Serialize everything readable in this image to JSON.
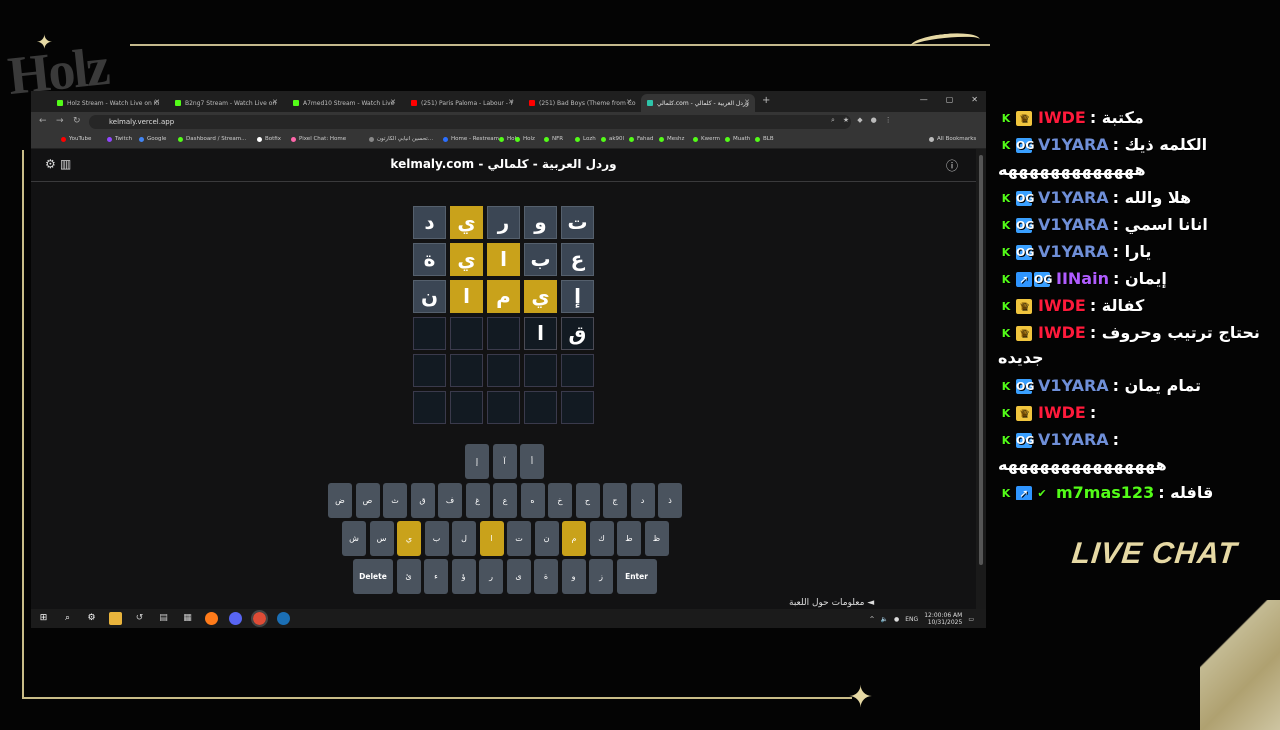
{
  "overlay": {
    "logo_text": "Holz",
    "live_chat_label": "LIVE CHAT"
  },
  "browser": {
    "tabs": [
      {
        "label": "Holz Stream - Watch Live on Ki",
        "color": "#53fc18"
      },
      {
        "label": "B2ng7 Stream - Watch Live on",
        "color": "#53fc18"
      },
      {
        "label": "A7med10 Stream - Watch Live",
        "color": "#53fc18"
      },
      {
        "label": "(251) Paris Paloma - Labour - Y",
        "color": "#ff0000"
      },
      {
        "label": "(251) Bad Boys (Theme from Co",
        "color": "#ff0000"
      },
      {
        "label": "كلمالي.com - وردل العربية - كلمالي",
        "color": "#2ec4a9"
      }
    ],
    "url": "kelmaly.vercel.app",
    "bookmarks": [
      "YouTube",
      "Twitch",
      "Google",
      "Dashboard / Stream...",
      "Botfix",
      "Pixel Chat: Home",
      "تحسين انيابي الكارتون...",
      "Home - Restream",
      "Holz",
      "Holz",
      "NFR",
      "Lozh",
      "ak90l",
      "Fahad",
      "Meshz",
      "Kwerm",
      "Muath",
      "BLB",
      "All Bookmarks"
    ]
  },
  "game": {
    "title": "kelmaly.com - وردل العربية - كلمالي",
    "board": [
      [
        {
          "l": "د",
          "s": "filled"
        },
        {
          "l": "ي",
          "s": "present"
        },
        {
          "l": "ر",
          "s": "filled"
        },
        {
          "l": "و",
          "s": "filled"
        },
        {
          "l": "ت",
          "s": "filled"
        }
      ],
      [
        {
          "l": "ة",
          "s": "filled"
        },
        {
          "l": "ي",
          "s": "present"
        },
        {
          "l": "ا",
          "s": "present"
        },
        {
          "l": "ب",
          "s": "filled"
        },
        {
          "l": "ع",
          "s": "filled"
        }
      ],
      [
        {
          "l": "ن",
          "s": "filled"
        },
        {
          "l": "ا",
          "s": "present"
        },
        {
          "l": "م",
          "s": "present"
        },
        {
          "l": "ي",
          "s": "present"
        },
        {
          "l": "إ",
          "s": "filled"
        }
      ],
      [
        {
          "l": "",
          "s": "empty"
        },
        {
          "l": "",
          "s": "empty"
        },
        {
          "l": "",
          "s": "empty"
        },
        {
          "l": "ا",
          "s": "typed"
        },
        {
          "l": "ق",
          "s": "typed"
        }
      ],
      [
        {
          "l": "",
          "s": "empty"
        },
        {
          "l": "",
          "s": "empty"
        },
        {
          "l": "",
          "s": "empty"
        },
        {
          "l": "",
          "s": "empty"
        },
        {
          "l": "",
          "s": "empty"
        }
      ],
      [
        {
          "l": "",
          "s": "empty"
        },
        {
          "l": "",
          "s": "empty"
        },
        {
          "l": "",
          "s": "empty"
        },
        {
          "l": "",
          "s": "empty"
        },
        {
          "l": "",
          "s": "empty"
        }
      ]
    ],
    "keyboard": {
      "row1": [
        {
          "l": "إ"
        },
        {
          "l": "آ"
        },
        {
          "l": "أ"
        }
      ],
      "row2": [
        {
          "l": "ض"
        },
        {
          "l": "ص"
        },
        {
          "l": "ث"
        },
        {
          "l": "ق"
        },
        {
          "l": "ف"
        },
        {
          "l": "غ"
        },
        {
          "l": "ع"
        },
        {
          "l": "ه"
        },
        {
          "l": "خ"
        },
        {
          "l": "ح"
        },
        {
          "l": "ج"
        },
        {
          "l": "د"
        },
        {
          "l": "ذ"
        }
      ],
      "row3": [
        {
          "l": "ش"
        },
        {
          "l": "س"
        },
        {
          "l": "ي",
          "s": "present"
        },
        {
          "l": "ب"
        },
        {
          "l": "ل"
        },
        {
          "l": "ا",
          "s": "present"
        },
        {
          "l": "ت"
        },
        {
          "l": "ن"
        },
        {
          "l": "م",
          "s": "present"
        },
        {
          "l": "ك"
        },
        {
          "l": "ط"
        },
        {
          "l": "ظ"
        }
      ],
      "row4": [
        {
          "l": "Delete",
          "w": true
        },
        {
          "l": "ئ"
        },
        {
          "l": "ء"
        },
        {
          "l": "ؤ"
        },
        {
          "l": "ر"
        },
        {
          "l": "ى"
        },
        {
          "l": "ة"
        },
        {
          "l": "و"
        },
        {
          "l": "ز"
        },
        {
          "l": "Enter",
          "w": true
        }
      ]
    },
    "about_link": "معلومات حول اللعبة ◄"
  },
  "taskbar": {
    "lang": "ENG",
    "time": "12:00:06 AM",
    "date": "10/31/2025"
  },
  "chat": {
    "messages": [
      {
        "badges": [
          "crown"
        ],
        "name": "IWDE",
        "cls": "n-iwde",
        "text": ": مكتبة"
      },
      {
        "badges": [
          "og"
        ],
        "name": "V1YARA",
        "cls": "n-v1",
        "text": ": الكلمه ذيك",
        "cont": "هههههههههههههه"
      },
      {
        "badges": [
          "og"
        ],
        "name": "V1YARA",
        "cls": "n-v1",
        "text": ": هلا والله"
      },
      {
        "badges": [
          "og"
        ],
        "name": "V1YARA",
        "cls": "n-v1",
        "text": ": انانا اسمي"
      },
      {
        "badges": [
          "og"
        ],
        "name": "V1YARA",
        "cls": "n-v1",
        "text": ": يارا"
      },
      {
        "badges": [
          "boost",
          "og"
        ],
        "name": "IINain",
        "cls": "n-nain",
        "text": ": إيمان"
      },
      {
        "badges": [
          "crown"
        ],
        "name": "IWDE",
        "cls": "n-iwde",
        "text": ": كفالة"
      },
      {
        "badges": [
          "crown"
        ],
        "name": "IWDE",
        "cls": "n-iwde",
        "text": ": نحتاج ترتيب وحروف",
        "cont": "جديده"
      },
      {
        "badges": [
          "og"
        ],
        "name": "V1YARA",
        "cls": "n-v1",
        "text": ": تمام يمان"
      },
      {
        "badges": [
          "crown"
        ],
        "name": "IWDE",
        "cls": "n-iwde",
        "text": ":"
      },
      {
        "badges": [
          "og"
        ],
        "name": "V1YARA",
        "cls": "n-v1",
        "text": ":",
        "cont": "هههههههههههههههه"
      },
      {
        "badges": [
          "boost",
          "check"
        ],
        "name": "m7mas123",
        "cls": "n-m7",
        "text": ": قافله"
      }
    ]
  }
}
